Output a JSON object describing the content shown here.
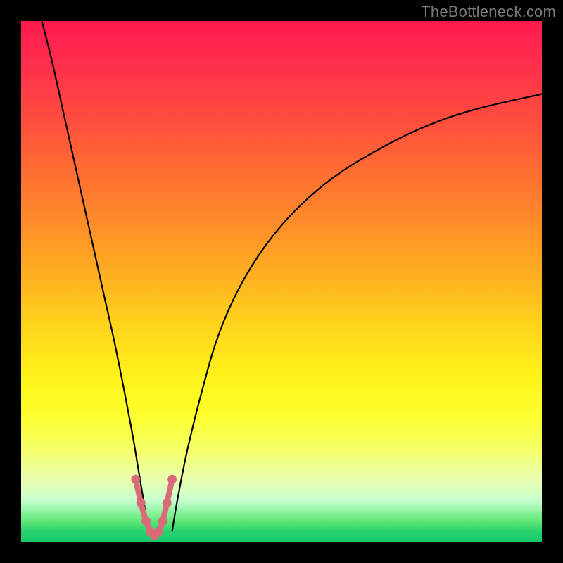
{
  "watermark": {
    "text": "TheBottleneck.com"
  },
  "chart_data": {
    "type": "line",
    "title": "",
    "xlabel": "",
    "ylabel": "",
    "xlim": [
      0,
      100
    ],
    "ylim": [
      0,
      100
    ],
    "grid": false,
    "legend": false,
    "background_gradient": {
      "orientation": "vertical",
      "stops": [
        {
          "pos": 0.0,
          "color": "#ff1a4d"
        },
        {
          "pos": 0.3,
          "color": "#ff7a2e"
        },
        {
          "pos": 0.6,
          "color": "#ffd21c"
        },
        {
          "pos": 0.8,
          "color": "#fcff2e"
        },
        {
          "pos": 0.93,
          "color": "#c8ffcf"
        },
        {
          "pos": 1.0,
          "color": "#18c96a"
        }
      ]
    },
    "series": [
      {
        "name": "left-branch",
        "color": "#000000",
        "x": [
          4,
          6,
          8,
          10,
          12,
          14,
          16,
          18,
          20,
          21.5,
          22.5,
          23.5,
          24.5
        ],
        "values": [
          100,
          92,
          83,
          74,
          65,
          56,
          47,
          38,
          28,
          20,
          14,
          8,
          2
        ]
      },
      {
        "name": "right-branch",
        "color": "#000000",
        "x": [
          29,
          30,
          32,
          35,
          38,
          42,
          47,
          53,
          60,
          68,
          77,
          87,
          100
        ],
        "values": [
          2,
          8,
          18,
          30,
          40,
          49,
          57,
          64,
          70,
          75,
          79.5,
          83,
          86
        ]
      },
      {
        "name": "valley-markers",
        "color": "#d96b78",
        "marker": "circle",
        "x": [
          22.0,
          23.0,
          24.0,
          24.8,
          25.6,
          26.4,
          27.2,
          28.0,
          29.0
        ],
        "values": [
          12.0,
          7.5,
          4.0,
          2.0,
          1.2,
          2.0,
          4.0,
          7.5,
          12.0
        ]
      },
      {
        "name": "valley-connector",
        "color": "#d96b78",
        "x": [
          22.0,
          23.0,
          24.0,
          24.8,
          25.6,
          26.4,
          27.2,
          28.0,
          29.0
        ],
        "values": [
          12.0,
          7.5,
          4.0,
          2.0,
          1.2,
          2.0,
          4.0,
          7.5,
          12.0
        ]
      }
    ]
  }
}
